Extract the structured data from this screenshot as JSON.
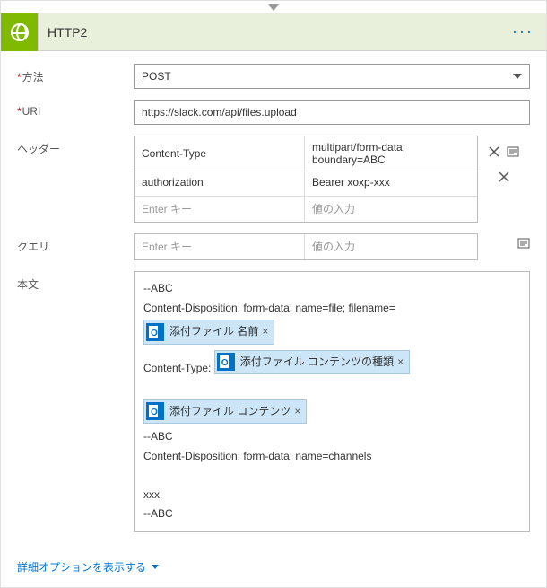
{
  "header": {
    "title": "HTTP2",
    "more": "···"
  },
  "labels": {
    "method": "方法",
    "uri": "URI",
    "headers": "ヘッダー",
    "query": "クエリ",
    "body": "本文"
  },
  "method": {
    "value": "POST"
  },
  "uri": {
    "value": "https://slack.com/api/files.upload"
  },
  "placeholders": {
    "key": "Enter キー",
    "value": "値の入力"
  },
  "headers_rows": [
    {
      "key": "Content-Type",
      "value": "multipart/form-data; boundary=ABC",
      "removable": true,
      "code": true
    },
    {
      "key": "authorization",
      "value": "Bearer xoxp-xxx",
      "removable": true,
      "code": false
    }
  ],
  "body": {
    "l1": "--ABC",
    "l2": "Content-Disposition: form-data; name=file; filename=",
    "token1": "添付ファイル 名前",
    "l3": "Content-Type:",
    "token2": "添付ファイル コンテンツの種類",
    "token3": "添付ファイル コンテンツ",
    "l4": "--ABC",
    "l5": "Content-Disposition: form-data; name=channels",
    "l6": "xxx",
    "l7": "--ABC"
  },
  "advanced": "詳細オプションを表示する"
}
